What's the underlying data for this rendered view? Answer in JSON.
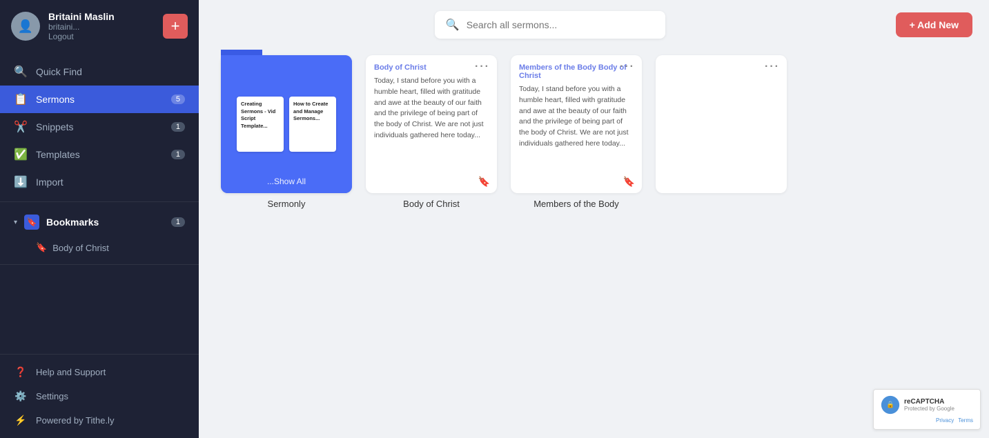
{
  "sidebar": {
    "user": {
      "name": "Britaini Maslin",
      "email": "britaini...",
      "logout": "Logout"
    },
    "add_button_label": "+",
    "quick_find_label": "Quick Find",
    "nav_items": [
      {
        "id": "sermons",
        "label": "Sermons",
        "badge": "5",
        "active": true,
        "icon": "📋"
      },
      {
        "id": "snippets",
        "label": "Snippets",
        "badge": "1",
        "active": false,
        "icon": "✂️"
      },
      {
        "id": "templates",
        "label": "Templates",
        "badge": "1",
        "active": false,
        "icon": "✅"
      },
      {
        "id": "import",
        "label": "Import",
        "badge": "",
        "active": false,
        "icon": "⬇️"
      }
    ],
    "bookmarks": {
      "label": "Bookmarks",
      "badge": "1",
      "items": [
        {
          "label": "Body of Christ",
          "icon": "🔖"
        }
      ]
    },
    "footer_items": [
      {
        "id": "help",
        "label": "Help and Support",
        "icon": "❓"
      },
      {
        "id": "settings",
        "label": "Settings",
        "icon": "⚙️"
      },
      {
        "id": "powered",
        "label": "Powered by Tithe.ly",
        "icon": "⚡"
      }
    ]
  },
  "topbar": {
    "search_placeholder": "Search all sermons...",
    "add_new_label": "+ Add New"
  },
  "cards": [
    {
      "id": "sermonly",
      "type": "folder",
      "label": "Sermonly",
      "show_all": "...Show All",
      "docs": [
        {
          "title": "Creating Sermons - Vid Script Template..."
        },
        {
          "title": "How to Create and Manage Sermons..."
        }
      ]
    },
    {
      "id": "body-of-christ",
      "type": "text",
      "label": "Body of Christ",
      "church": "Body of Christ",
      "text": "Today, I stand before you with a humble heart, filled with gratitude and awe at the beauty of our faith and the privilege of being part of the body of Christ. We are not just individuals gathered here today..."
    },
    {
      "id": "members-of-body",
      "type": "text",
      "label": "Members of the Body",
      "church": "Members of the Body Body of Christ",
      "text": "Today, I stand before you with a humble heart, filled with gratitude and awe at the beauty of our faith and the privilege of being part of the body of Christ. We are not just individuals gathered here today..."
    },
    {
      "id": "empty-card",
      "type": "empty",
      "label": ""
    }
  ],
  "recaptcha": {
    "text": "reCAPTCHA",
    "links": [
      "Privacy",
      "Terms"
    ]
  }
}
